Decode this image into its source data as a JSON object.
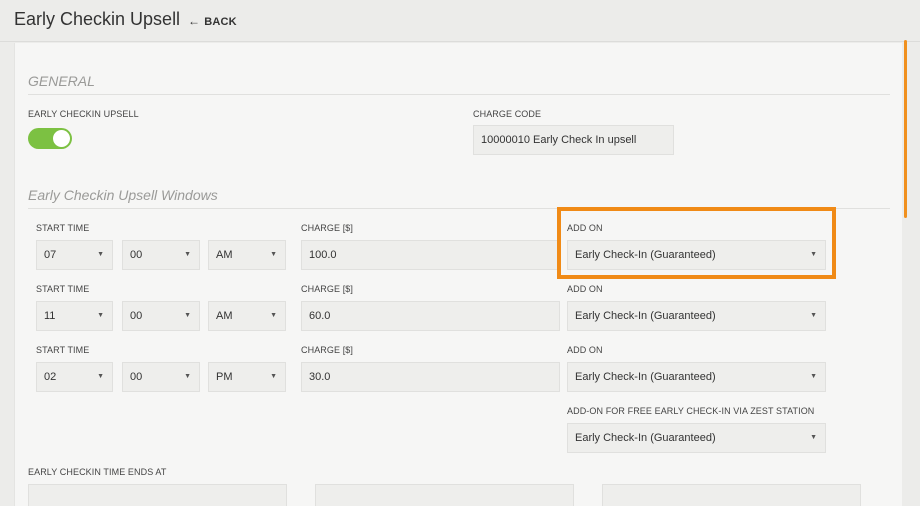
{
  "header": {
    "title": "Early Checkin Upsell",
    "back_label": "BACK"
  },
  "general": {
    "section_title": "GENERAL",
    "upsell_label": "EARLY CHECKIN UPSELL",
    "upsell_enabled": true,
    "charge_code_label": "CHARGE CODE",
    "charge_code_value": "10000010 Early Check In upsell"
  },
  "windows": {
    "section_title": "Early Checkin Upsell Windows",
    "rows": [
      {
        "start_label": "START TIME",
        "hour": "07",
        "minute": "00",
        "ampm": "AM",
        "charge_label": "CHARGE [$]",
        "charge": "100.0",
        "addon_label": "ADD ON",
        "addon": "Early Check-In (Guaranteed)"
      },
      {
        "start_label": "START TIME",
        "hour": "11",
        "minute": "00",
        "ampm": "AM",
        "charge_label": "CHARGE [$]",
        "charge": "60.0",
        "addon_label": "ADD ON",
        "addon": "Early Check-In (Guaranteed)"
      },
      {
        "start_label": "START TIME",
        "hour": "02",
        "minute": "00",
        "ampm": "PM",
        "charge_label": "CHARGE [$]",
        "charge": "30.0",
        "addon_label": "ADD ON",
        "addon": "Early Check-In (Guaranteed)"
      }
    ],
    "zest_label": "ADD-ON FOR FREE EARLY CHECK-IN VIA ZEST STATION",
    "zest_value": "Early Check-In (Guaranteed)",
    "ends_label": "EARLY CHECKIN TIME ENDS AT"
  },
  "colors": {
    "toggle_on": "#7cc142",
    "highlight": "#f08a16",
    "scrollbar": "#f0901e"
  },
  "icons": {
    "back": "left-arrow-icon",
    "dropdown": "caret-down-icon"
  }
}
